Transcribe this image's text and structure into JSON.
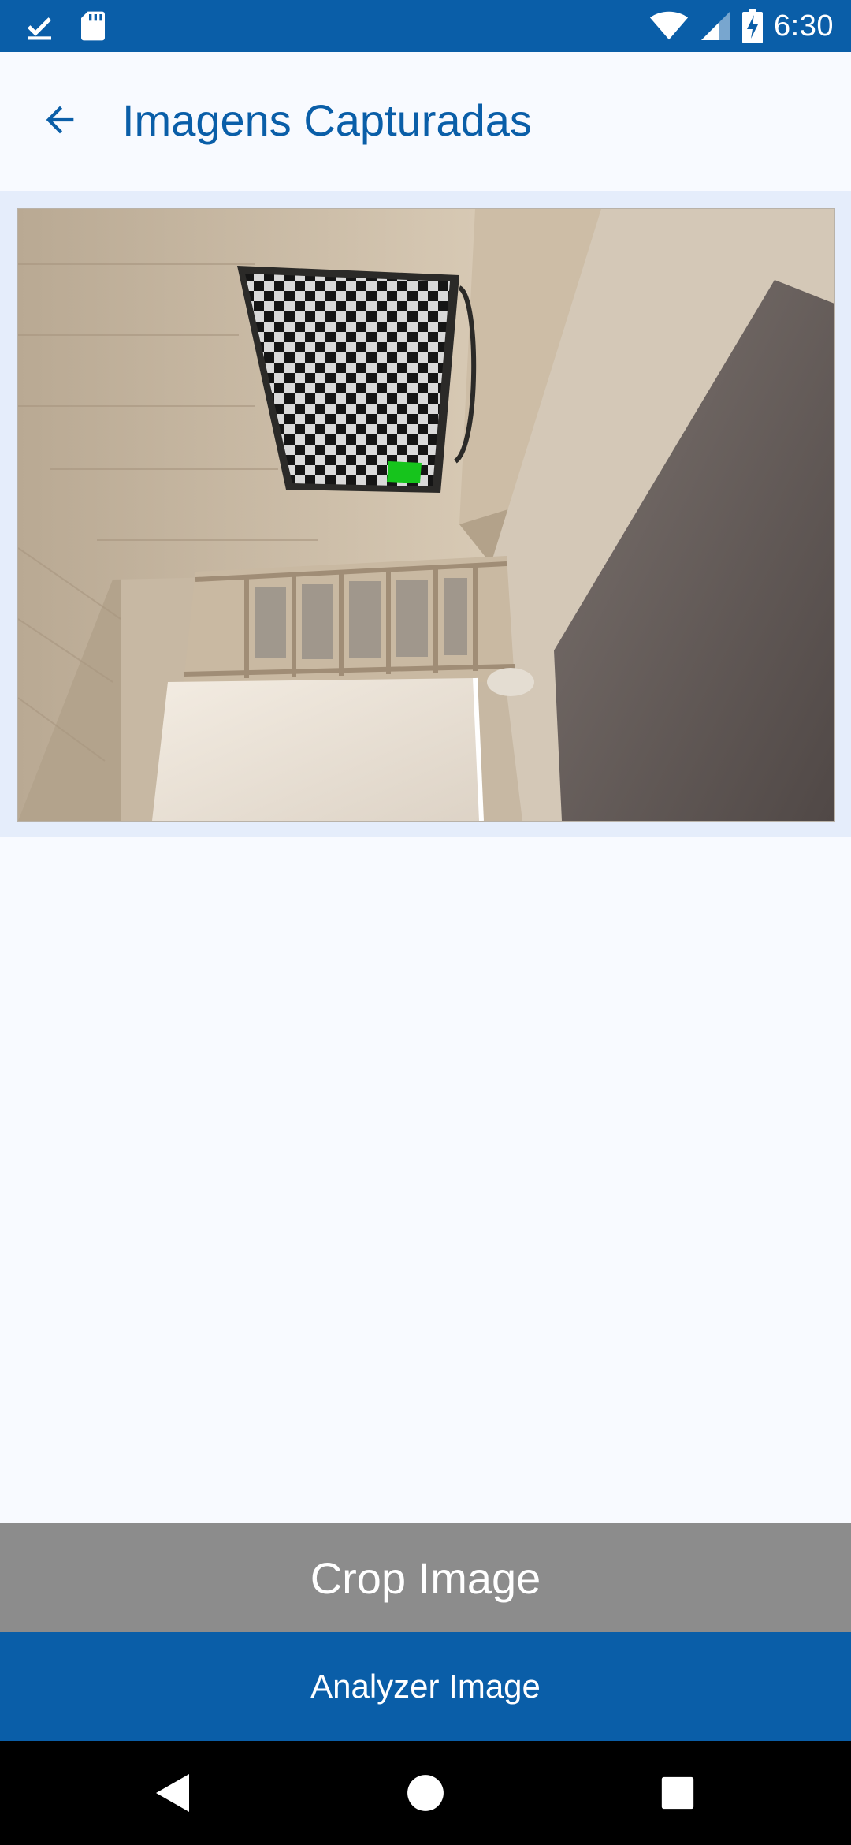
{
  "status_bar": {
    "time": "6:30",
    "icons": [
      "download-done-icon",
      "sd-card-icon",
      "wifi-icon",
      "cell-signal-icon",
      "battery-charging-icon"
    ]
  },
  "app_bar": {
    "back_icon": "arrow-back-icon",
    "title": "Imagens Capturadas"
  },
  "image": {
    "description_icon": "captured-room-photo"
  },
  "actions": {
    "crop_label": "Crop Image",
    "analyze_label": "Analyzer Image"
  },
  "nav_bar": {
    "icons": [
      "back-triangle-icon",
      "home-circle-icon",
      "recents-square-icon"
    ]
  },
  "colors": {
    "primary": "#0a5ea8",
    "crop_button": "#8c8c8c",
    "image_strip": "#e5edfb",
    "background": "#f8faff",
    "marker_green": "#16c41c"
  }
}
